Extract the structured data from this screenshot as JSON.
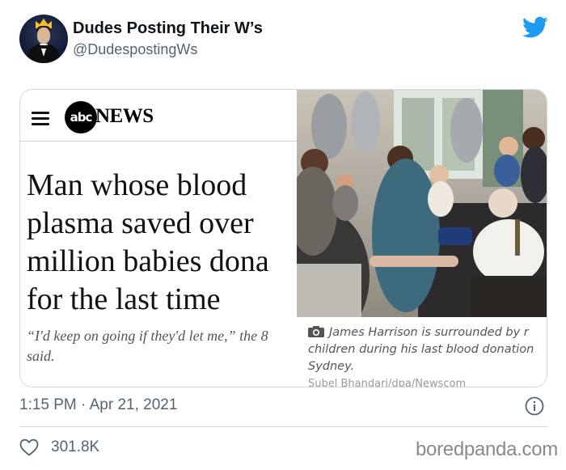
{
  "user": {
    "display_name": "Dudes Posting Their W’s",
    "handle": "@DudespostingWs",
    "avatar_icon": "avatar-crowned-man-icon",
    "platform_icon": "twitter-bird-icon",
    "brand_color": "#1d9bf0"
  },
  "article": {
    "outlet_logo_text": "abc",
    "outlet_name": "NEWS",
    "headline_lines": [
      "Man whose blood",
      "plasma saved over",
      "million babies dona",
      "for the last time"
    ],
    "quote_lines": [
      "“I'd keep on going if they'd let me,” the 8",
      "said."
    ],
    "caption_lines": [
      "James Harrison is surrounded by r",
      "children during his last blood donation",
      "Sydney."
    ],
    "photo_credit": "Subel Bhandari/dpa/Newscom"
  },
  "meta": {
    "timestamp": "1:15 PM · Apr 21, 2021",
    "like_count": "301.8K"
  },
  "watermark": "boredpanda.com"
}
